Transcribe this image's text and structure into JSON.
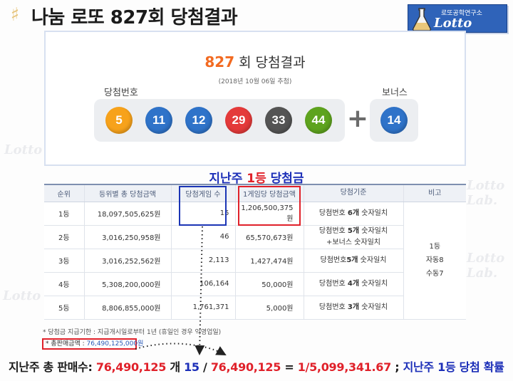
{
  "header": {
    "title": "나눔 로또 827회 당첨결과",
    "brand_sub": "로또공학연구소",
    "brand_name": "Lotto Lab."
  },
  "result": {
    "round_number": "827",
    "round_suffix": " 회 당첨결과",
    "draw_date": "(2018년 10월 06일 추첨)",
    "winning_label": "당첨번호",
    "bonus_label": "보너스",
    "numbers": [
      "5",
      "11",
      "12",
      "29",
      "33",
      "44"
    ],
    "bonus": "14",
    "plus": "+"
  },
  "colors": {
    "yellow": "#f7a21b",
    "blue": "#2f73c9",
    "red": "#e43a3a",
    "gray": "#545454",
    "green": "#5ea31e",
    "accent_red": "#e0212a",
    "accent_blue": "#1c2fb8"
  },
  "watermark": "Lotto Lab.",
  "table": {
    "heading_pre": "지난주 ",
    "heading_red": "1등",
    "heading_post": " 당첨금",
    "columns": [
      "순위",
      "등위별 총 당첨금액",
      "당첨게임 수",
      "1게임당 당첨금액",
      "당첨기준",
      "비고"
    ],
    "rows": [
      {
        "rank": "1등",
        "total": "18,097,505,625원",
        "count": "15",
        "each": "1,206,500,375원",
        "crit_pre": "당첨번호 ",
        "crit_bold": "6개",
        "crit_post": " 숫자일치",
        "crit_line2": ""
      },
      {
        "rank": "2등",
        "total": "3,016,250,958원",
        "count": "46",
        "each": "65,570,673원",
        "crit_pre": "당첨번호 ",
        "crit_bold": "5개",
        "crit_post": " 숫자일치",
        "crit_line2": "+보너스 숫자일치"
      },
      {
        "rank": "3등",
        "total": "3,016,252,562원",
        "count": "2,113",
        "each": "1,427,474원",
        "crit_pre": "당첨번호",
        "crit_bold": "5개",
        "crit_post": " 숫자일치",
        "crit_line2": ""
      },
      {
        "rank": "4등",
        "total": "5,308,200,000원",
        "count": "106,164",
        "each": "50,000원",
        "crit_pre": "당첨번호 ",
        "crit_bold": "4개",
        "crit_post": " 숫자일치",
        "crit_line2": ""
      },
      {
        "rank": "5등",
        "total": "8,806,855,000원",
        "count": "1,761,371",
        "each": "5,000원",
        "crit_pre": "당첨번호 ",
        "crit_bold": "3개",
        "crit_post": " 숫자일치",
        "crit_line2": ""
      }
    ],
    "note_lines": [
      "1등",
      "자동8",
      "수동7"
    ]
  },
  "notes": {
    "payout": "* 당첨금 지급기한 : 지급개시일로부터 1년 (휴일인 경우 익영업일)",
    "sales_label": "* 총판매금액 : ",
    "sales_amount": "76,490,125,000원"
  },
  "formula": {
    "label": "지난주 총 판매수: ",
    "sales": "76,490,125",
    "unit": " 개  ",
    "winners": "15",
    "slash": " / ",
    "sales2": "76,490,125",
    "equals": "  =  ",
    "prob": "1/5,099,341.67",
    "semi": "   ; ",
    "desc": "지난주 1등 당첨 확률"
  }
}
